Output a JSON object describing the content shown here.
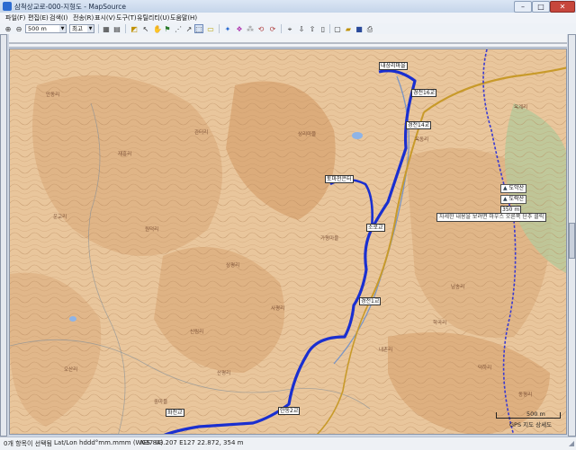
{
  "window": {
    "title": "삼척상교로-000-지형도 - MapSource",
    "minimize": "–",
    "maximize": "□",
    "close": "✕"
  },
  "menubar": {
    "items": [
      {
        "label": "파일(F)"
      },
      {
        "label": "편집(E)"
      },
      {
        "label": "검색(I)"
      },
      {
        "label": "전송(R)"
      },
      {
        "label": "표시(V)"
      },
      {
        "label": "도구(T)"
      },
      {
        "label": "유틸리티(U)"
      },
      {
        "label": "도움말(H)"
      }
    ]
  },
  "toolbar": {
    "zoom_value": "500 m",
    "detail_value": "최고"
  },
  "waypoints": [
    {
      "label": "내상리마을"
    },
    {
      "label": "경전16교"
    },
    {
      "label": "경전14교"
    },
    {
      "label": "토마천은터"
    },
    {
      "label": "소로교"
    },
    {
      "label": "경전1교"
    },
    {
      "label": "화천교"
    },
    {
      "label": "안동2교"
    }
  ],
  "peaks": [
    {
      "label": "도악산"
    },
    {
      "label": "도락산"
    }
  ],
  "map": {
    "elevation_label": "350 m",
    "notice": "자세한 내용을 보려면 마우스 오른쪽 단추 클릭",
    "scale_label": "500 m",
    "attribution": "GPS 지도 상세도",
    "place_labels": [
      {
        "text": "재흥리"
      },
      {
        "text": "관터리"
      },
      {
        "text": "상리마을"
      },
      {
        "text": "운교리"
      },
      {
        "text": "원덕리"
      },
      {
        "text": "상평리"
      },
      {
        "text": "가평마을"
      },
      {
        "text": "옥동리"
      },
      {
        "text": "신림리"
      },
      {
        "text": "오산리"
      },
      {
        "text": "사평리"
      },
      {
        "text": "중마을"
      },
      {
        "text": "남송리"
      },
      {
        "text": "학곡리"
      },
      {
        "text": "옥계리"
      },
      {
        "text": "덕하리"
      },
      {
        "text": "내촌리"
      },
      {
        "text": "산평리"
      },
      {
        "text": "동평리"
      },
      {
        "text": "안동리"
      }
    ]
  },
  "statusbar": {
    "selection": "0개 항목이 선택됨",
    "format": "Lat/Lon hddd°mm.mmm (WGS 84)",
    "position": "N37 03.207 E127 22.872, 354 m"
  }
}
